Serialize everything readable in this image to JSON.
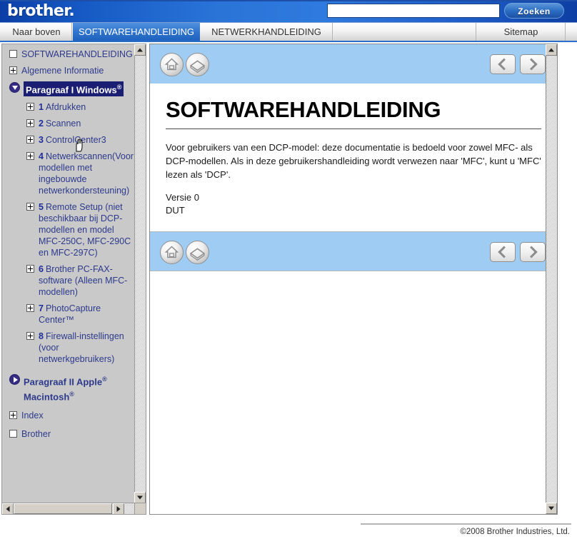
{
  "brand": {
    "logo_text": "brother."
  },
  "search": {
    "value": "",
    "placeholder": "",
    "button_label": "Zoeken"
  },
  "tabs": [
    {
      "label": "Naar boven",
      "active": false
    },
    {
      "label": "SOFTWAREHANDLEIDING",
      "active": true
    },
    {
      "label": "NETWERKHANDLEIDING",
      "active": false
    },
    {
      "label": "Sitemap",
      "active": false
    }
  ],
  "sidebar": {
    "nodes": [
      {
        "icon": "box-empty",
        "label": "SOFTWAREHANDLEIDING",
        "level": 1
      },
      {
        "icon": "box-plus",
        "label": "Algemene Informatie",
        "level": 1
      },
      {
        "icon": "circle-down",
        "label": "Paragraaf I Windows",
        "sup": "®",
        "level": 1,
        "selected": true
      },
      {
        "icon": "box-plus",
        "num": "1",
        "label": "Afdrukken",
        "level": 2
      },
      {
        "icon": "box-plus",
        "num": "2",
        "label": "Scannen",
        "level": 2
      },
      {
        "icon": "box-plus",
        "num": "3",
        "label": "ControlCenter3",
        "level": 2
      },
      {
        "icon": "box-plus",
        "num": "4",
        "label": "Netwerkscannen(Voor modellen met ingebouwde netwerkondersteuning)",
        "level": 2
      },
      {
        "icon": "box-plus",
        "num": "5",
        "label": "Remote Setup (niet beschikbaar bij DCP-modellen en model MFC-250C, MFC-290C en MFC-297C)",
        "level": 2
      },
      {
        "icon": "box-plus",
        "num": "6",
        "label": "Brother PC-FAX-software (Alleen MFC-modellen)",
        "level": 2
      },
      {
        "icon": "box-plus",
        "num": "7",
        "label": "PhotoCapture Center™",
        "level": 2
      },
      {
        "icon": "box-plus",
        "num": "8",
        "label": "Firewall-instellingen (voor netwerkgebruikers)",
        "level": 2
      },
      {
        "icon": "circle-right",
        "label": "Paragraaf II Apple",
        "sup": "®",
        "label2": "Macintosh",
        "sup2": "®",
        "level": 1,
        "bold": true
      },
      {
        "icon": "box-plus",
        "label": "Index",
        "level": 1
      },
      {
        "icon": "box-empty",
        "label": "Brother",
        "level": 1
      }
    ]
  },
  "content": {
    "nav": {
      "home_icon": "home-icon",
      "book_icon": "book-icon",
      "prev_label": "prev-arrow",
      "next_label": "next-arrow"
    },
    "title": "SOFTWAREHANDLEIDING",
    "paragraph": "Voor gebruikers van een DCP-model: deze documentatie is bedoeld voor zowel MFC- als DCP-modellen. Als in deze gebruikershandleiding wordt verwezen naar 'MFC', kunt u 'MFC' lezen als 'DCP'.",
    "version": "Versie 0",
    "language": "DUT"
  },
  "footer": {
    "copyright": "©2008 Brother Industries, Ltd."
  },
  "colors": {
    "brand_blue": "#2d72cb",
    "nav_band": "#9fccf2",
    "selected_tree": "#1b1f73",
    "tree_text": "#2d3a8c"
  }
}
